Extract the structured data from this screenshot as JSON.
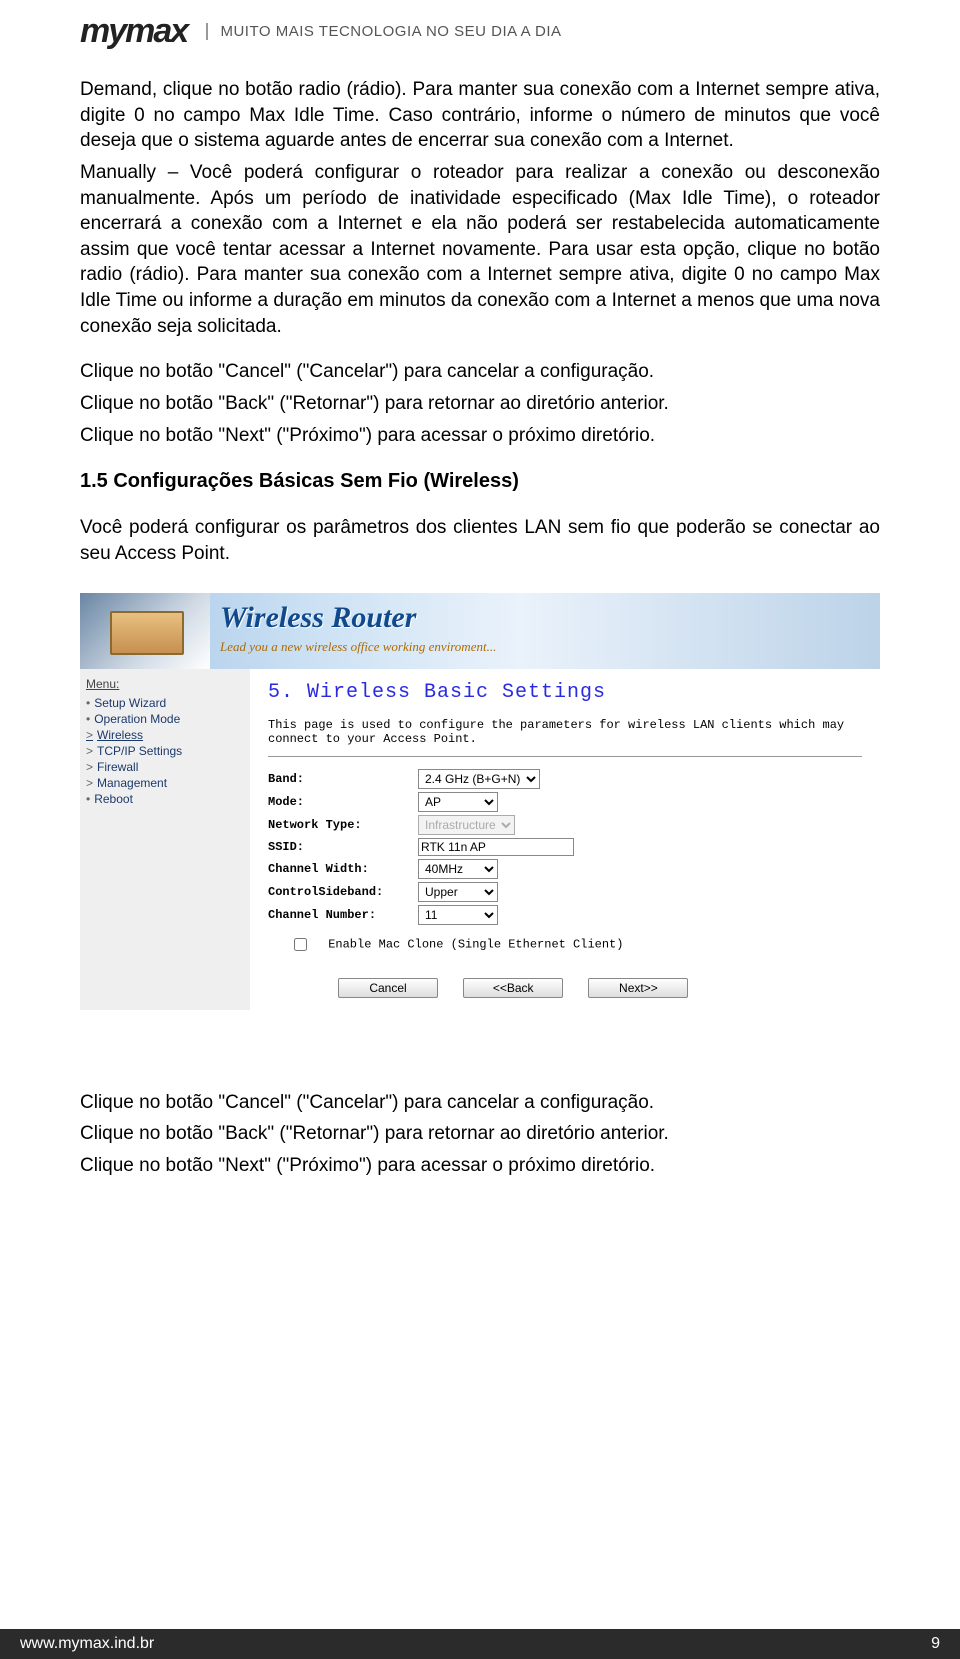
{
  "header": {
    "brand": "mymax",
    "tagline": "MUITO MAIS TECNOLOGIA NO SEU DIA A DIA"
  },
  "body": {
    "p1": "Demand, clique no botão radio (rádio). Para manter sua conexão com a Internet sempre ativa, digite 0 no campo Max Idle Time. Caso contrário, informe o número de minutos que você deseja que o sistema aguarde antes de encerrar sua conexão com a Internet.",
    "p2": "Manually – Você poderá configurar o roteador para realizar a conexão ou desconexão manualmente. Após um período de inatividade especificado (Max Idle Time), o roteador encerrará a conexão com a Internet e ela não poderá ser restabelecida automaticamente assim que você tentar acessar a Internet novamente. Para usar esta opção, clique no botão radio (rádio). Para manter sua conexão com a Internet sempre ativa, digite 0 no campo Max Idle Time ou informe a duração em minutos da conexão com a Internet a menos que uma nova conexão seja solicitada.",
    "cancel": "Clique no botão \"Cancel\" (\"Cancelar\") para cancelar a configuração.",
    "back": "Clique no botão \"Back\" (\"Retornar\") para retornar ao diretório anterior.",
    "next": "Clique no botão \"Next\" (\"Próximo\") para acessar o próximo diretório.",
    "heading": "1.5 Configurações Básicas Sem Fio (Wireless)",
    "lead": "Você poderá configurar os parâmetros dos clientes LAN sem fio que poderão se conectar ao seu Access Point.",
    "cancel2": "Clique no botão \"Cancel\" (\"Cancelar\") para cancelar a configuração.",
    "back2": "Clique no botão \"Back\" (\"Retornar\") para retornar ao diretório anterior.",
    "next2": "Clique no botão \"Next\" (\"Próximo\") para acessar o próximo diretório."
  },
  "router": {
    "banner_title": "Wireless Router",
    "banner_sub": "Lead you a new wireless office working enviroment...",
    "menu_title": "Menu:",
    "menu_items": [
      {
        "bullet": "•",
        "label": "Setup Wizard"
      },
      {
        "bullet": "•",
        "label": "Operation Mode"
      },
      {
        "bullet": ">",
        "label": "Wireless"
      },
      {
        "bullet": ">",
        "label": "TCP/IP Settings"
      },
      {
        "bullet": ">",
        "label": "Firewall"
      },
      {
        "bullet": ">",
        "label": "Management"
      },
      {
        "bullet": "•",
        "label": "Reboot"
      }
    ],
    "panel_title": "5. Wireless Basic Settings",
    "panel_desc": "This page is used to configure the parameters for wireless LAN clients which may connect to your Access Point.",
    "labels": {
      "band": "Band:",
      "mode": "Mode:",
      "nettype": "Network Type:",
      "ssid": "SSID:",
      "chwidth": "Channel Width:",
      "sideband": "ControlSideband:",
      "chnum": "Channel Number:"
    },
    "values": {
      "band": "2.4 GHz (B+G+N)",
      "mode": "AP",
      "nettype": "Infrastructure",
      "ssid": "RTK 11n AP",
      "chwidth": "40MHz",
      "sideband": "Upper",
      "chnum": "11"
    },
    "mac_clone": "Enable Mac Clone (Single Ethernet Client)",
    "btn_cancel": "Cancel",
    "btn_back": "<<Back",
    "btn_next": "Next>>"
  },
  "footer": {
    "url": "www.mymax.ind.br",
    "page": "9"
  }
}
